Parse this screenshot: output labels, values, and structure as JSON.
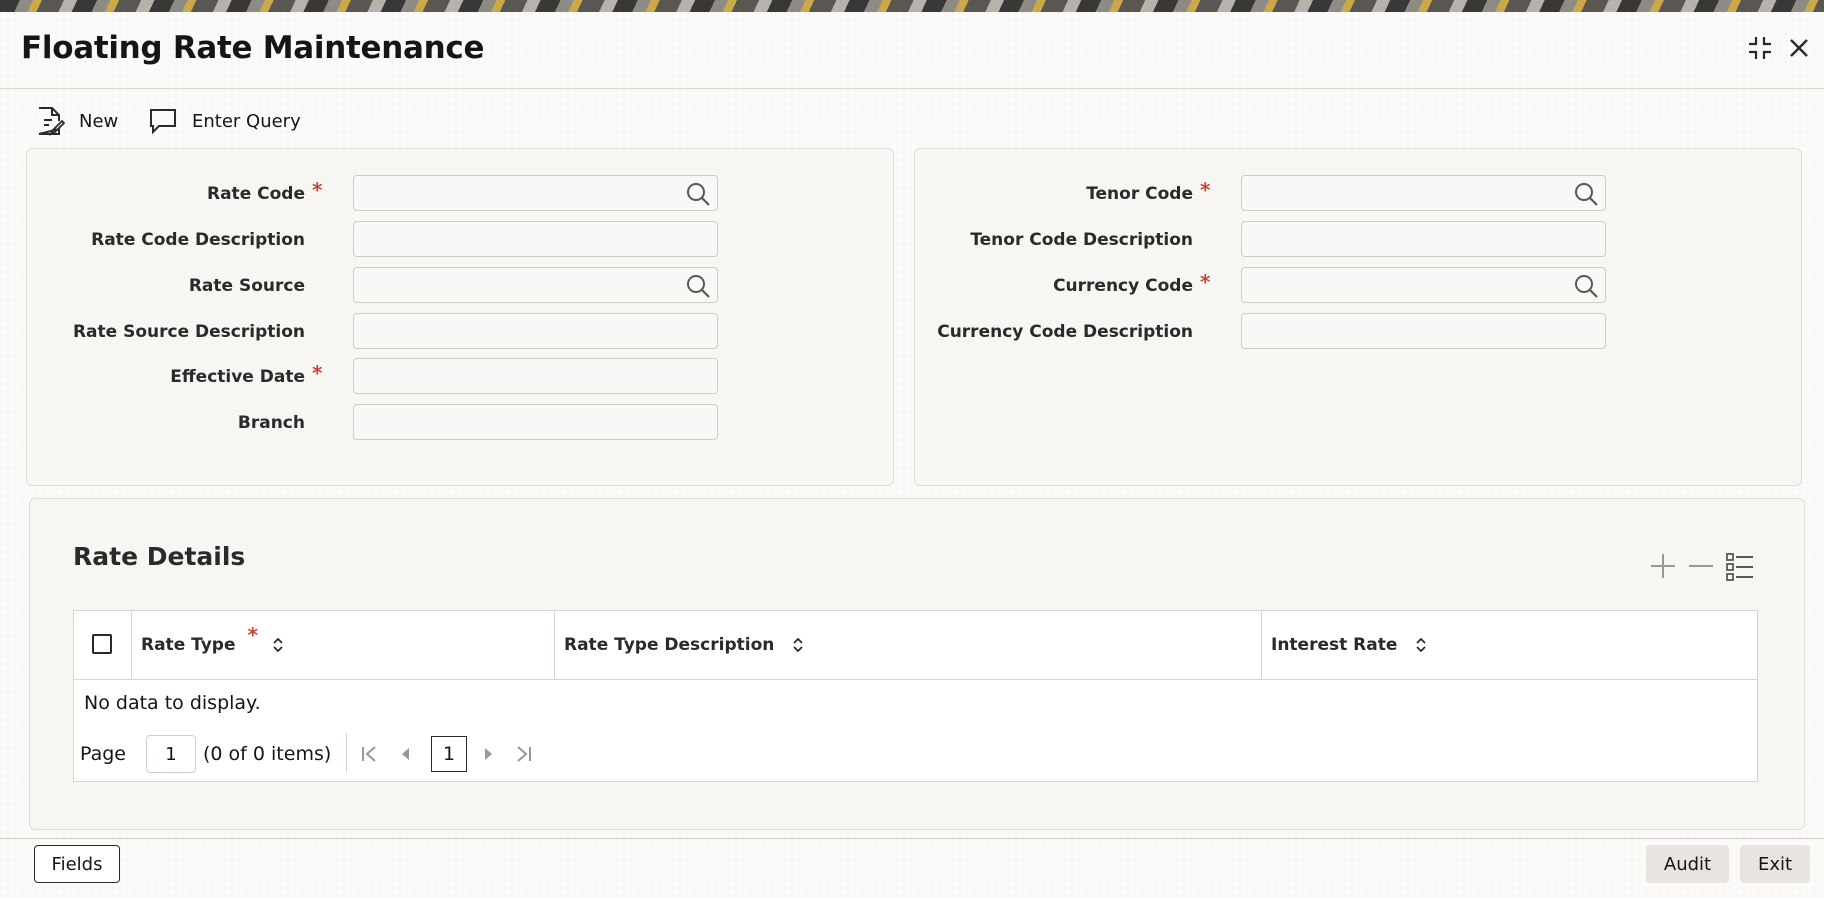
{
  "window": {
    "title": "Floating Rate Maintenance"
  },
  "toolbar": {
    "new_label": "New",
    "enter_query_label": "Enter Query"
  },
  "left_form": {
    "rate_code": {
      "label": "Rate Code",
      "required": "*",
      "value": ""
    },
    "rate_code_description": {
      "label": "Rate Code Description",
      "value": ""
    },
    "rate_source": {
      "label": "Rate Source",
      "value": ""
    },
    "rate_source_description": {
      "label": "Rate Source Description",
      "value": ""
    },
    "effective_date": {
      "label": "Effective Date",
      "required": "*",
      "value": ""
    },
    "branch": {
      "label": "Branch",
      "value": ""
    }
  },
  "right_form": {
    "tenor_code": {
      "label": "Tenor Code",
      "required": "*",
      "value": ""
    },
    "tenor_code_description": {
      "label": "Tenor Code Description",
      "value": ""
    },
    "currency_code": {
      "label": "Currency Code",
      "required": "*",
      "value": ""
    },
    "currency_code_description": {
      "label": "Currency Code Description",
      "value": ""
    }
  },
  "rate_details": {
    "title": "Rate Details",
    "columns": [
      {
        "label": "Rate Type",
        "required": "*"
      },
      {
        "label": "Rate Type Description"
      },
      {
        "label": "Interest Rate"
      }
    ],
    "empty_text": "No data to display.",
    "pagination": {
      "page_label": "Page",
      "page_value": "1",
      "items_text": "(0 of 0 items)",
      "current_page": "1"
    }
  },
  "footer": {
    "fields_label": "Fields",
    "audit_label": "Audit",
    "exit_label": "Exit"
  },
  "colors": {
    "accent_required": "#c74634",
    "icon": "#5a5855",
    "icon_disabled": "#9a9794"
  }
}
